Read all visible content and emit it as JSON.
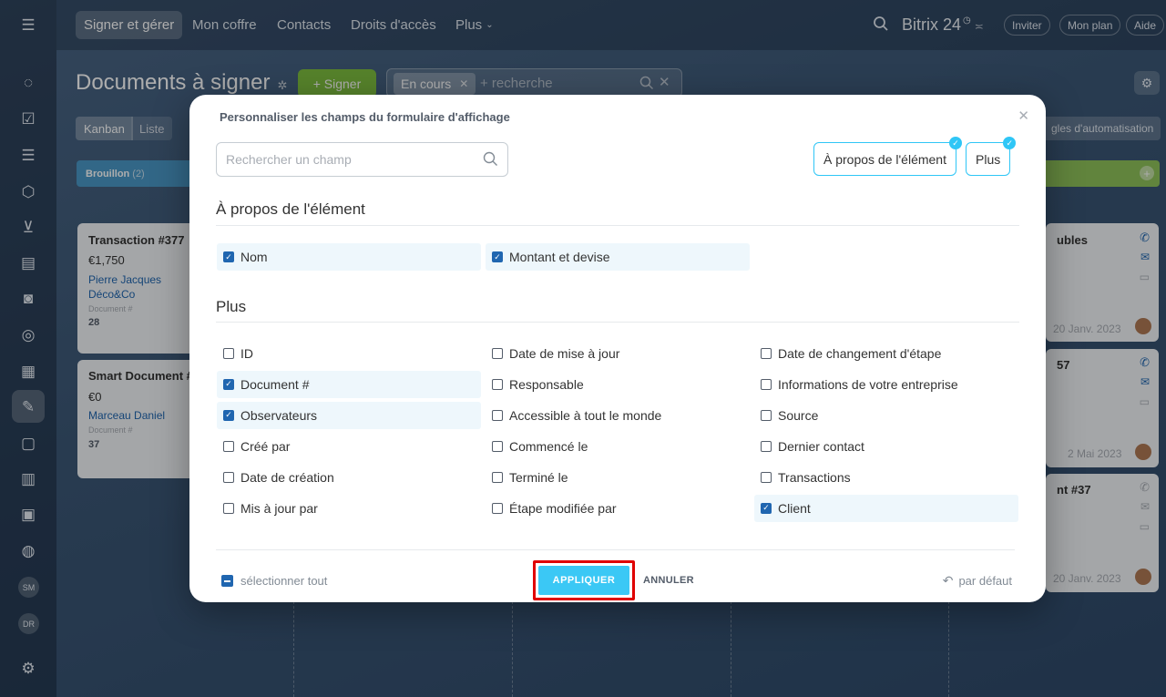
{
  "topbar": {
    "nav": [
      "Signer et gérer",
      "Mon coffre",
      "Contacts",
      "Droits d'accès",
      "Plus"
    ],
    "logo": "Bitrix 24",
    "invite": "Inviter",
    "plan": "Mon plan",
    "help": "Aide"
  },
  "sidebar": {
    "icons": [
      "activity-icon",
      "tasks-icon",
      "filter-icon",
      "box-icon",
      "cart-icon",
      "contact-card-icon",
      "robot-icon",
      "target-icon",
      "building-icon",
      "sign-icon",
      "document-edit-icon",
      "chart-icon",
      "calendar-icon",
      "support-icon",
      "settings-icon"
    ],
    "avatars": [
      "SM",
      "DR"
    ]
  },
  "page": {
    "title": "Documents à signer",
    "sign_button": "+ Signer",
    "filter_tag": "En cours",
    "search_placeholder": "+ recherche",
    "view_kanban": "Kanban",
    "view_list": "Liste",
    "automation": "gles d'automatisation",
    "column_draft": "Brouillon",
    "column_draft_count": "(2)"
  },
  "cards": [
    {
      "title": "Transaction #377",
      "amount": "€1,750",
      "contact": "Pierre Jacques",
      "company": "Déco&Co",
      "doc_label": "Document #",
      "doc_value": "28"
    },
    {
      "title": "Smart Document #",
      "amount": "€0",
      "contact": "Marceau Daniel",
      "doc_label": "Document #",
      "doc_value": "37"
    }
  ],
  "right_cards": [
    {
      "title": "ubles",
      "date": "20 Janv. 2023"
    },
    {
      "title": "57",
      "date": "2 Mai 2023"
    },
    {
      "title": "nt #37",
      "date": "20 Janv. 2023"
    }
  ],
  "modal": {
    "title": "Personnaliser les champs du formulaire d'affichage",
    "search_placeholder": "Rechercher un champ",
    "section_buttons": [
      "À propos de l'élément",
      "Plus"
    ],
    "section_about": {
      "title": "À propos de l'élément",
      "fields": [
        {
          "label": "Nom",
          "checked": true
        },
        {
          "label": "Montant et devise",
          "checked": true
        }
      ]
    },
    "section_more": {
      "title": "Plus",
      "columns": [
        [
          {
            "label": "ID",
            "checked": false
          },
          {
            "label": "Document #",
            "checked": true
          },
          {
            "label": "Observateurs",
            "checked": true
          },
          {
            "label": "Créé par",
            "checked": false
          },
          {
            "label": "Date de création",
            "checked": false
          },
          {
            "label": "Mis à jour par",
            "checked": false
          }
        ],
        [
          {
            "label": "Date de mise à jour",
            "checked": false
          },
          {
            "label": "Responsable",
            "checked": false
          },
          {
            "label": "Accessible à tout le monde",
            "checked": false
          },
          {
            "label": "Commencé le",
            "checked": false
          },
          {
            "label": "Terminé le",
            "checked": false
          },
          {
            "label": "Étape modifiée par",
            "checked": false
          }
        ],
        [
          {
            "label": "Date de changement d'étape",
            "checked": false
          },
          {
            "label": "Informations de votre entreprise",
            "checked": false
          },
          {
            "label": "Source",
            "checked": false
          },
          {
            "label": "Dernier contact",
            "checked": false
          },
          {
            "label": "Transactions",
            "checked": false
          },
          {
            "label": "Client",
            "checked": true
          }
        ]
      ]
    },
    "select_all": "sélectionner tout",
    "apply": "APPLIQUER",
    "cancel": "ANNULER",
    "default": "par défaut"
  },
  "colors": {
    "accent": "#2fc6f6",
    "apply": "#3bc8f5",
    "sign_green": "#7fc040",
    "highlight_frame": "#e00000",
    "checkbox": "#2066b0"
  }
}
